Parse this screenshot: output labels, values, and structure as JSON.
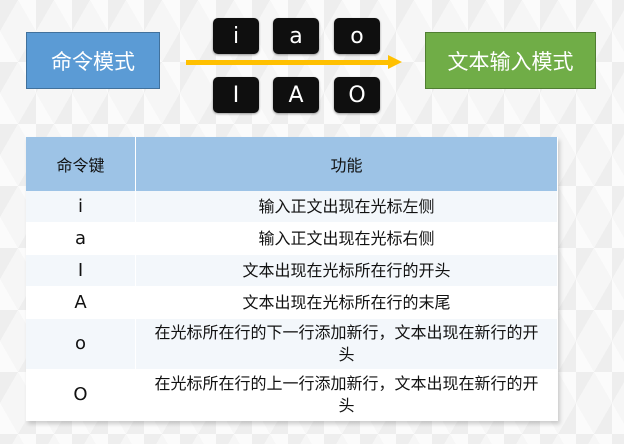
{
  "diagram": {
    "command_mode_label": "命令模式",
    "text_mode_label": "文本输入模式",
    "arrow_color": "#ffc000",
    "keys_top": [
      "i",
      "a",
      "o"
    ],
    "keys_bottom": [
      "I",
      "A",
      "O"
    ]
  },
  "table": {
    "headers": [
      "命令键",
      "功能"
    ],
    "header_bg": "#9dc3e6",
    "rows": [
      {
        "key": "i",
        "desc": "输入正文出现在光标左侧"
      },
      {
        "key": "a",
        "desc": "输入正文出现在光标右侧"
      },
      {
        "key": "I",
        "desc": "文本出现在光标所在行的开头"
      },
      {
        "key": "A",
        "desc": "文本出现在光标所在行的末尾"
      },
      {
        "key": "o",
        "desc": "在光标所在行的下一行添加新行，文本出现在新行的开头"
      },
      {
        "key": "O",
        "desc": "在光标所在行的上一行添加新行，文本出现在新行的开头"
      }
    ]
  }
}
